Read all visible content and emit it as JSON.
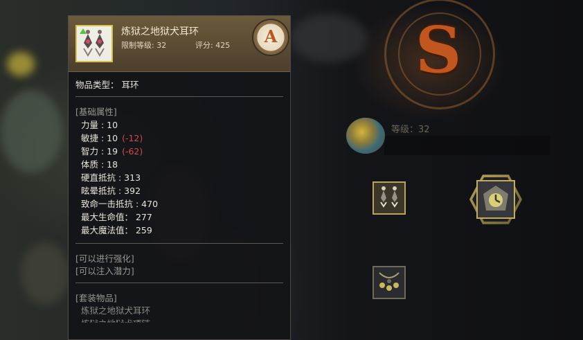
{
  "tooltip": {
    "item_name": "炼狱之地狱犬耳环",
    "level_req": "限制等级: 32",
    "score": "评分: 425",
    "grade": "A",
    "item_icon": "earring-icon",
    "type_line": "物品类型： 耳环",
    "base_header": "[基础属性]",
    "stats": [
      {
        "label": "力量 : 10",
        "diff": ""
      },
      {
        "label": "敏捷 : 10",
        "diff": "(-12)"
      },
      {
        "label": "智力 : 19",
        "diff": "(-62)"
      },
      {
        "label": "体质 : 18",
        "diff": ""
      },
      {
        "label": "硬直抵抗 : 313",
        "diff": ""
      },
      {
        "label": "眩晕抵抗 : 392",
        "diff": ""
      },
      {
        "label": "致命一击抵抗 : 470",
        "diff": ""
      },
      {
        "label": "最大生命值： 277",
        "diff": ""
      },
      {
        "label": "最大魔法值： 259",
        "diff": ""
      }
    ],
    "enhance": "[可以进行强化]",
    "inject": "[可以注入潜力]",
    "set_header": "[套装物品]",
    "set_items": [
      "炼狱之地狱犬耳环",
      "炼狱之地狱犬项链"
    ]
  },
  "character_panel": {
    "rank": "S",
    "level": "等级：32",
    "icons": [
      "pet-portrait-icon",
      "earring-slot-icon",
      "necklace-slot-icon",
      "timer-badge-icon"
    ]
  },
  "colors": {
    "accent_gold": "#d8c24a",
    "negative": "#d44a44",
    "rank_orange": "#c2561f"
  }
}
